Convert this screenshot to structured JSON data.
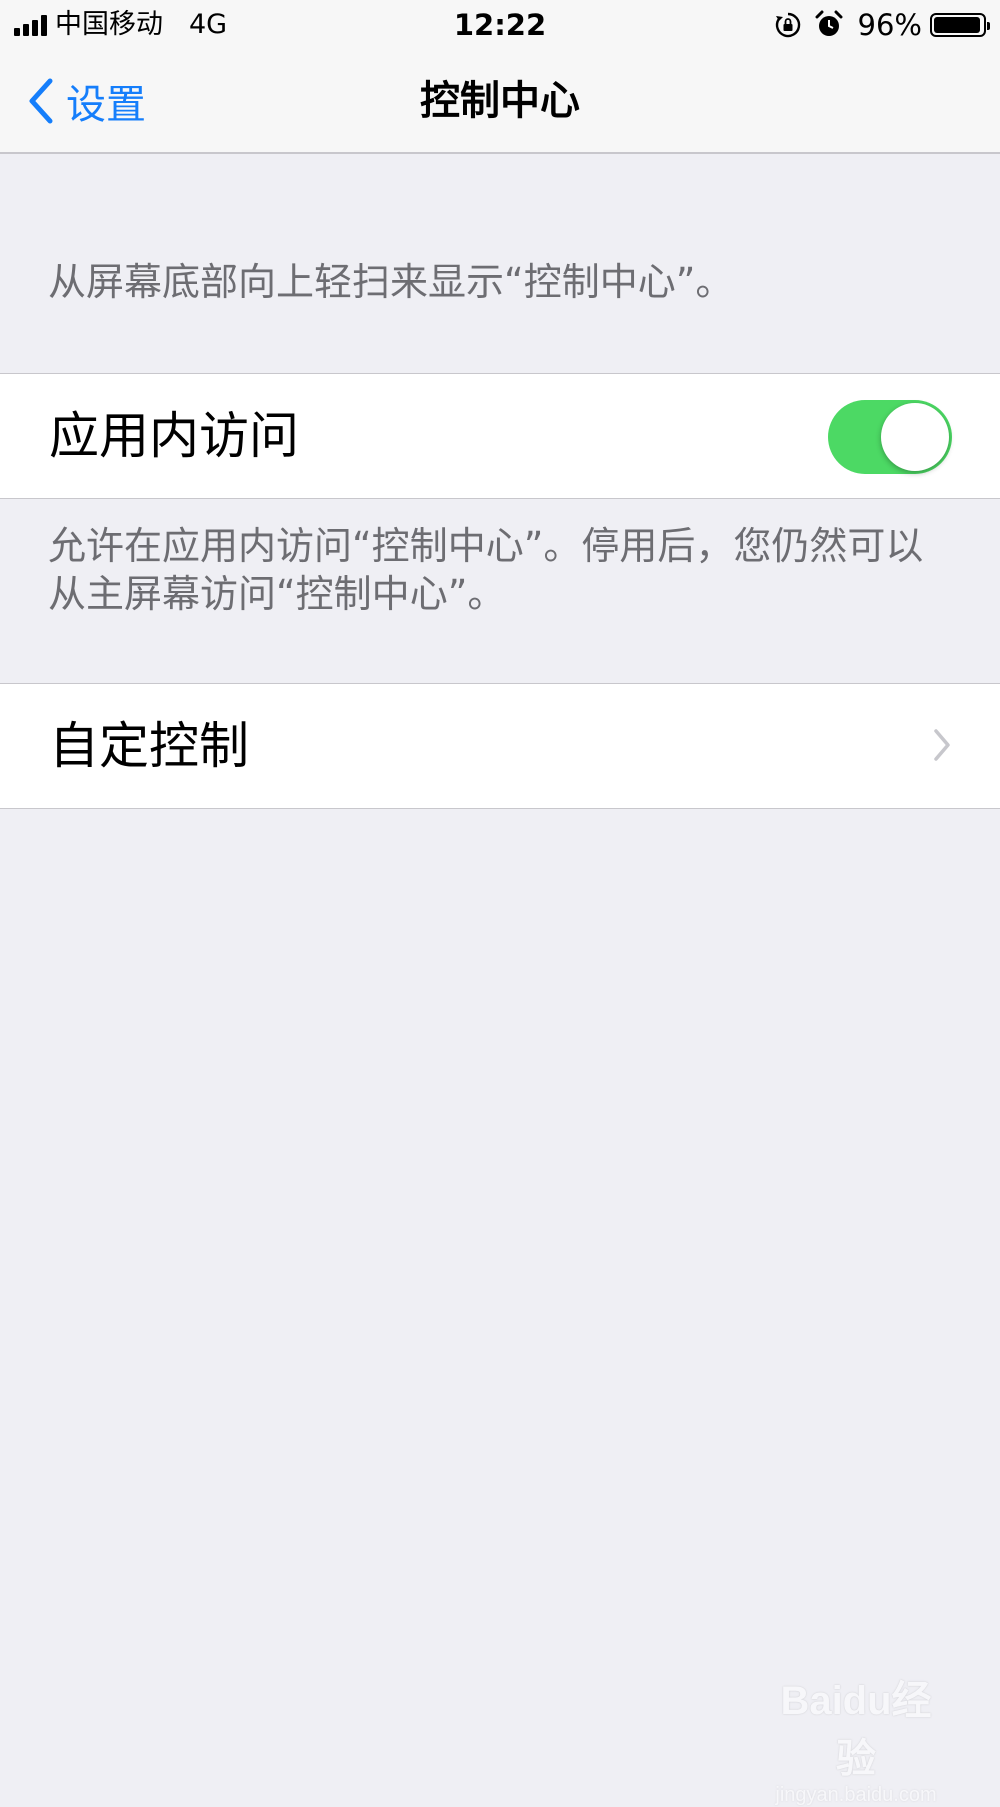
{
  "status_bar": {
    "carrier": "中国移动",
    "network": "4G",
    "time": "12:22",
    "battery_percent": "96%",
    "battery_level": 0.96,
    "icons": [
      "signal-icon",
      "orientation-lock-icon",
      "alarm-icon",
      "battery-icon"
    ]
  },
  "nav": {
    "back_label": "设置",
    "title": "控制中心"
  },
  "content": {
    "header_note": "从屏幕底部向上轻扫来显示“控制中心”。",
    "in_app_access": {
      "label": "应用内访问",
      "enabled": true
    },
    "footer_note": "允许在应用内访问“控制中心”。停用后，您仍然可以从主屏幕访问“控制中心”。",
    "customize": {
      "label": "自定控制"
    }
  },
  "watermark": {
    "logo": "Baidu经验",
    "url": "jingyan.baidu.com"
  },
  "colors": {
    "accent": "#157efb",
    "toggle_on": "#4cd964",
    "background": "#efeff4",
    "secondary_text": "#6d6d72"
  }
}
